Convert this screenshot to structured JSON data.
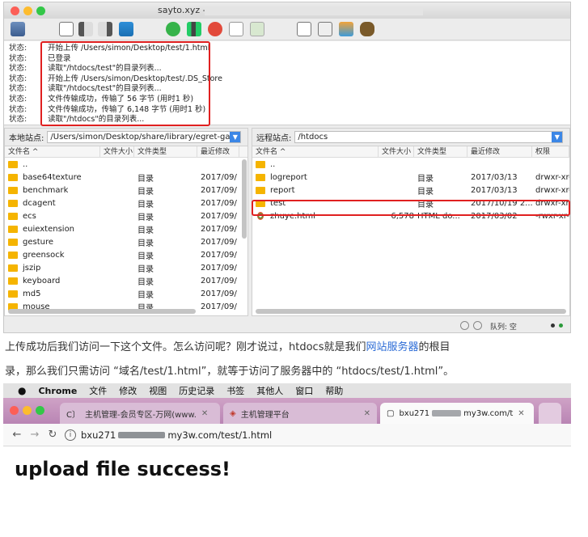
{
  "filezilla": {
    "window_title": "sayto.xyz -",
    "log": [
      {
        "label": "状态:",
        "message": "开始上传 /Users/simon/Desktop/test/1.html"
      },
      {
        "label": "状态:",
        "message": "已登录"
      },
      {
        "label": "状态:",
        "message": "读取\"/htdocs/test\"的目录列表..."
      },
      {
        "label": "状态:",
        "message": "开始上传 /Users/simon/Desktop/test/.DS_Store"
      },
      {
        "label": "状态:",
        "message": "读取\"/htdocs/test\"的目录列表..."
      },
      {
        "label": "状态:",
        "message": "文件传输成功，传输了 56 字节 (用时1 秒)"
      },
      {
        "label": "状态:",
        "message": "文件传输成功，传输了 6,148 字节 (用时1 秒)"
      },
      {
        "label": "状态:",
        "message": "读取\"/htdocs\"的目录列表..."
      }
    ],
    "local": {
      "site_label": "本地站点:",
      "path": "/Users/simon/Desktop/share/library/egret-gar",
      "columns": [
        "文件名 ^",
        "文件大小",
        "文件类型",
        "最近修改"
      ],
      "rows": [
        {
          "name": "..",
          "size": "",
          "type": "",
          "modified": "",
          "icon": "folder-icon"
        },
        {
          "name": "base64texture",
          "size": "",
          "type": "目录",
          "modified": "2017/09/",
          "icon": "folder-icon"
        },
        {
          "name": "benchmark",
          "size": "",
          "type": "目录",
          "modified": "2017/09/",
          "icon": "folder-icon"
        },
        {
          "name": "dcagent",
          "size": "",
          "type": "目录",
          "modified": "2017/09/",
          "icon": "folder-icon"
        },
        {
          "name": "ecs",
          "size": "",
          "type": "目录",
          "modified": "2017/09/",
          "icon": "folder-icon"
        },
        {
          "name": "euiextension",
          "size": "",
          "type": "目录",
          "modified": "2017/09/",
          "icon": "folder-icon"
        },
        {
          "name": "gesture",
          "size": "",
          "type": "目录",
          "modified": "2017/09/",
          "icon": "folder-icon"
        },
        {
          "name": "greensock",
          "size": "",
          "type": "目录",
          "modified": "2017/09/",
          "icon": "folder-icon"
        },
        {
          "name": "jszip",
          "size": "",
          "type": "目录",
          "modified": "2017/09/",
          "icon": "folder-icon"
        },
        {
          "name": "keyboard",
          "size": "",
          "type": "目录",
          "modified": "2017/09/",
          "icon": "folder-icon"
        },
        {
          "name": "md5",
          "size": "",
          "type": "目录",
          "modified": "2017/09/",
          "icon": "folder-icon"
        },
        {
          "name": "mouse",
          "size": "",
          "type": "目录",
          "modified": "2017/09/",
          "icon": "folder-icon"
        }
      ]
    },
    "remote": {
      "site_label": "远程站点:",
      "path": "/htdocs",
      "columns": [
        "文件名 ^",
        "文件大小",
        "文件类型",
        "最近修改",
        "权限"
      ],
      "rows": [
        {
          "name": "..",
          "size": "",
          "type": "",
          "modified": "",
          "perm": "",
          "icon": "folder-icon"
        },
        {
          "name": "logreport",
          "size": "",
          "type": "目录",
          "modified": "2017/03/13",
          "perm": "drwxr-xr-x",
          "icon": "folder-icon"
        },
        {
          "name": "report",
          "size": "",
          "type": "目录",
          "modified": "2017/03/13",
          "perm": "drwxr-xr-x",
          "icon": "folder-icon"
        },
        {
          "name": "test",
          "size": "",
          "type": "目录",
          "modified": "2017/10/19 2...",
          "perm": "drwxr-xr-x",
          "icon": "folder-icon"
        },
        {
          "name": "zhuye.html",
          "size": "6,578",
          "type": "HTML do...",
          "modified": "2017/03/02",
          "perm": "-rwxr-xr-x",
          "icon": "html-file-icon"
        }
      ]
    },
    "queue_label": "队列: 空"
  },
  "article": {
    "line1_before": "上传成功后我们访问一下这个文件。怎么访问呢？刚才说过，htdocs就是我们",
    "line1_link": "网站服务器",
    "line1_after": "的根目",
    "line2": "录，那么我们只需访问 “域名/test/1.html”，就等于访问了服务器中的 “htdocs/test/1.html”。"
  },
  "chrome": {
    "menu": [
      "Chrome",
      "文件",
      "修改",
      "视图",
      "历史记录",
      "书签",
      "其他人",
      "窗口",
      "帮助"
    ],
    "tabs": [
      {
        "title": "主机管理-会员专区-万网(www.",
        "favicon": "C〕"
      },
      {
        "title": "主机管理平台",
        "favicon": "◈"
      },
      {
        "title": "bxu271",
        "title_tail": "my3w.com/t",
        "favicon": "▢"
      }
    ],
    "url_prefix": "bxu271",
    "url_suffix": "my3w.com/test/1.html",
    "page_text": "upload file success!"
  },
  "colors": {
    "highlight_red": "#e02020",
    "folder": "#f5b400",
    "link": "#2b6bd6",
    "chrome_tabstrip": "#c596bf"
  }
}
